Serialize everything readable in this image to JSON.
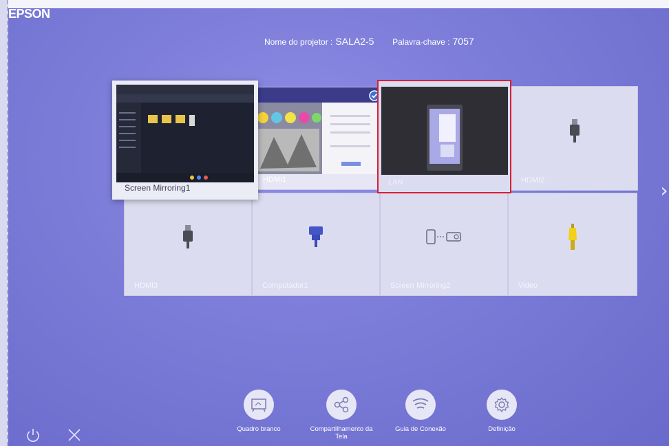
{
  "brand": {
    "logo": "EPSON"
  },
  "header": {
    "projector_name_label": "Nome do projetor :",
    "projector_name": "SALA2-5",
    "keyword_label": "Palavra-chave :",
    "keyword": "7057"
  },
  "sources": [
    {
      "label": "Screen Mirroring1",
      "state": "preview"
    },
    {
      "label": "HDMI1",
      "state": "active-checked"
    },
    {
      "label": "LAN",
      "state": "selected"
    },
    {
      "label": "HDMI2",
      "state": "idle"
    },
    {
      "label": "HDMI3",
      "state": "idle"
    },
    {
      "label": "Computador1",
      "state": "idle"
    },
    {
      "label": "Screen Mirroring2",
      "state": "idle"
    },
    {
      "label": "Video",
      "state": "idle"
    }
  ],
  "bottom_menu": [
    {
      "label": "Quadro branco",
      "icon": "whiteboard-icon"
    },
    {
      "label": "Compartilhamento da Tela",
      "icon": "share-icon"
    },
    {
      "label": "Guia de Conexão",
      "icon": "wifi-icon"
    },
    {
      "label": "Definição",
      "icon": "gear-icon"
    }
  ],
  "colors": {
    "background": "#7b7bd8",
    "selection_border": "#d81e35",
    "tile": "#dcdcf0",
    "check_badge": "#3b6fd8"
  }
}
